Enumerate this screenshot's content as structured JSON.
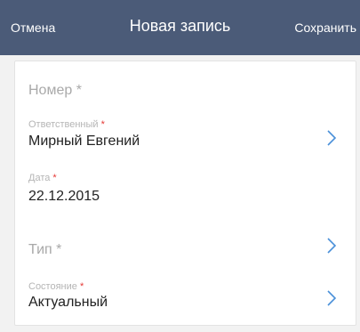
{
  "header": {
    "cancel_label": "Отмена",
    "title": "Новая запись",
    "save_label": "Сохранить"
  },
  "form": {
    "number": {
      "placeholder": "Номер",
      "required_mark": "*"
    },
    "responsible": {
      "label": "Ответственный",
      "required_mark": "*",
      "value": "Мирный Евгений"
    },
    "date": {
      "label": "Дата",
      "required_mark": "*",
      "value": "22.12.2015"
    },
    "type": {
      "placeholder": "Тип",
      "required_mark": "*"
    },
    "state": {
      "label": "Состояние",
      "required_mark": "*",
      "value": "Актуальный"
    }
  },
  "colors": {
    "header_bg": "#4b5b78",
    "required": "#e53935",
    "chevron": "#4a90d9"
  },
  "icons": [
    "chevron-right-icon"
  ]
}
